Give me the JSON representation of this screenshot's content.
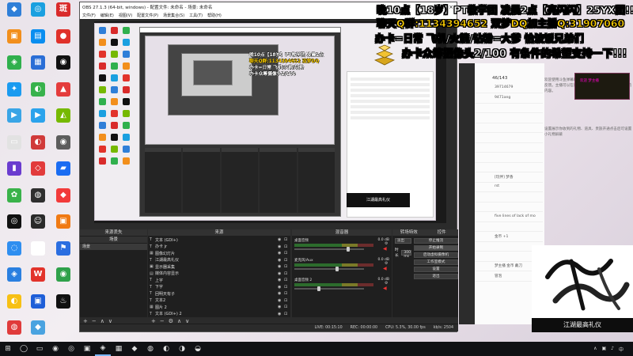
{
  "desktop": {
    "icons": [
      {
        "label": "",
        "color": "#2f7fd8",
        "glyph": "◆"
      },
      {
        "label": "",
        "color": "#1aa0e0",
        "glyph": "◎"
      },
      {
        "label": "",
        "color": "#d92b2b",
        "glyph": "斑"
      },
      {
        "label": "",
        "color": "#f28f1c",
        "glyph": "▣"
      },
      {
        "label": "",
        "color": "#0a8ef0",
        "glyph": "▤"
      },
      {
        "label": "",
        "color": "#e0312a",
        "glyph": "●"
      },
      {
        "label": "",
        "color": "#30b04d",
        "glyph": "◈"
      },
      {
        "label": "",
        "color": "#2a6ed6",
        "glyph": "▦"
      },
      {
        "label": "",
        "color": "#111",
        "glyph": "◉"
      },
      {
        "label": "",
        "color": "#1b9bf0",
        "glyph": "✦"
      },
      {
        "label": "",
        "color": "#38b24c",
        "glyph": "◐"
      },
      {
        "label": "",
        "color": "#e43c3c",
        "glyph": "▲"
      },
      {
        "label": "",
        "color": "#3aa5e6",
        "glyph": "▶"
      },
      {
        "label": "",
        "color": "#2ba3ec",
        "glyph": "▶"
      },
      {
        "label": "",
        "color": "#76b900",
        "glyph": "◭"
      },
      {
        "label": "",
        "color": "#e2e2e2",
        "glyph": "▭"
      },
      {
        "label": "",
        "color": "#d03a3a",
        "glyph": "◐"
      },
      {
        "label": "",
        "color": "#5c5c5c",
        "glyph": "◉"
      },
      {
        "label": "",
        "color": "#6a3ccf",
        "glyph": "▮"
      },
      {
        "label": "",
        "color": "#e23b3b",
        "glyph": "◇"
      },
      {
        "label": "",
        "color": "#1a6cf2",
        "glyph": "▰"
      },
      {
        "label": "",
        "color": "#3ab24a",
        "glyph": "✿"
      },
      {
        "label": "",
        "color": "#2f2f2f",
        "glyph": "◍"
      },
      {
        "label": "",
        "color": "#f23a3a",
        "glyph": "◆"
      },
      {
        "label": "",
        "color": "#111",
        "glyph": "◎"
      },
      {
        "label": "",
        "color": "#2a2a2a",
        "glyph": "☺"
      },
      {
        "label": "",
        "color": "#f07a14",
        "glyph": "▣"
      },
      {
        "label": "",
        "color": "#2f8ef0",
        "glyph": "◌"
      },
      {
        "label": "",
        "color": "#ffffff",
        "glyph": "◎"
      },
      {
        "label": "",
        "color": "#2b6ee0",
        "glyph": "⚑"
      },
      {
        "label": "",
        "color": "#2a7fe0",
        "glyph": "◈"
      },
      {
        "label": "",
        "color": "#e2332b",
        "glyph": "W"
      },
      {
        "label": "",
        "color": "#2fa14a",
        "glyph": "◉"
      },
      {
        "label": "",
        "color": "#f7c014",
        "glyph": "◐"
      },
      {
        "label": "",
        "color": "#1f5fd8",
        "glyph": "▣"
      },
      {
        "label": "",
        "color": "#111",
        "glyph": "♨"
      },
      {
        "label": "",
        "color": "#e03b3b",
        "glyph": "◍"
      },
      {
        "label": "",
        "color": "#4aa3e0",
        "glyph": "◆"
      }
    ]
  },
  "overlay": {
    "line1": "晚10点【18岁】PT教学团 凌晨2点【亮闪闪】25YX团!!",
    "line2": "聊天Q群:1134394652 双梦DQ加主播Q:31907060",
    "line3": "办卡=日常 飞机/火箭/钻粉=大爹 恰波饭兄弟们",
    "line4": "办卡众筹摄像头2/100 有条件的希望支持一下!!!"
  },
  "obs": {
    "title": "OBS 27.1.3 (64-bit, windows) - 配置文件: 未命名 - 场景: 未命名",
    "menu": [
      "文件(F)",
      "编辑(E)",
      "视图(V)",
      "配置文件(P)",
      "场景集合(S)",
      "工具(T)",
      "帮助(H)"
    ],
    "inner_overlay": [
      "晚10点【18岁】PT教学团 凌晨2点",
      "聊天Q群:1134394652 双梦DQ",
      "办卡=日常 飞机/火箭/钻粉",
      "办卡众筹摄像头2/100"
    ],
    "inner_gift": "江湖最高礼仪",
    "docks": {
      "scenes_title": "场景",
      "sources_title": "来源",
      "mixer_title": "混音器",
      "transitions_title": "转场特效",
      "controls_title": "控件",
      "tab_scenes": "来源丢失",
      "scene_items": [
        "场景"
      ],
      "sources": [
        {
          "icon": "T",
          "name": "文本 (GDI+)"
        },
        {
          "icon": "T",
          "name": "办卡 jr"
        },
        {
          "icon": "▦",
          "name": "图像幻灯片"
        },
        {
          "icon": "T",
          "name": "江湖最高礼仪"
        },
        {
          "icon": "▣",
          "name": "显示器采集"
        },
        {
          "icon": "▤",
          "name": "媒体内容显示"
        },
        {
          "icon": "T",
          "name": "上字"
        },
        {
          "icon": "T",
          "name": "下字"
        },
        {
          "icon": "T",
          "name": "回明天有子"
        },
        {
          "icon": "T",
          "name": "文本2"
        },
        {
          "icon": "▦",
          "name": "图片 2"
        },
        {
          "icon": "T",
          "name": "文本 (GDI+) 2"
        }
      ],
      "mixer": [
        {
          "name": "桌面音频",
          "db": "0.0 dB",
          "level": 0.78
        },
        {
          "name": "麦克风/Aux",
          "db": "0.0 dB",
          "level": 0.62
        },
        {
          "name": "桌面音频 2",
          "db": "0.0 dB",
          "level": 0.35
        }
      ],
      "transition_type": "淡出",
      "transition_label": "时长",
      "transition_duration": "300 ms",
      "controls": [
        "停止推流",
        "开始录制",
        "启动虚拟摄像机",
        "工作室模式",
        "设置",
        "退出"
      ]
    },
    "status": {
      "live": "LIVE: 00:15:10",
      "rec": "REC: 00:00:00",
      "cpu": "CPU: 5.3%, 30.00 fps",
      "kbps": "kb/s: 2504"
    }
  },
  "chat": {
    "count": "46/143",
    "notice": "欢迎使用斗鱼弹幕助手，如有问题，请加入官方QQ群反馈。主播可以在设置中开启消息过滤，屏蔽不想看的内容。",
    "notice2": "设置展示你收到的礼物、道具、贵族开通点击后可设置小礼物屏蔽",
    "messages": [
      "39714679",
      "9471ang",
      "",
      "",
      "",
      "",
      "",
      "",
      "",
      "[玩伴]  梦香",
      "rst",
      "",
      "",
      "five lines of lack of mo",
      "",
      "金币 +1",
      "",
      "",
      "梦主播  金币 戴刀",
      "冒泡"
    ],
    "banner": "欢迎 梦主播"
  },
  "logo": {
    "label": "江湖最高礼仪"
  },
  "taskbar": {
    "items": [
      "⊞",
      "◯",
      "▭",
      "◉",
      "◎",
      "▣",
      "◈",
      "▦",
      "◆",
      "◍",
      "◐",
      "◑",
      "◒"
    ],
    "tray": [
      "∧",
      "▣",
      "♪",
      "中"
    ],
    "time": "",
    "date": ""
  },
  "colors": {
    "obs_bg": "#2b2b2b",
    "overlay_yellow": "#ffd100",
    "live_red": "#e33"
  }
}
